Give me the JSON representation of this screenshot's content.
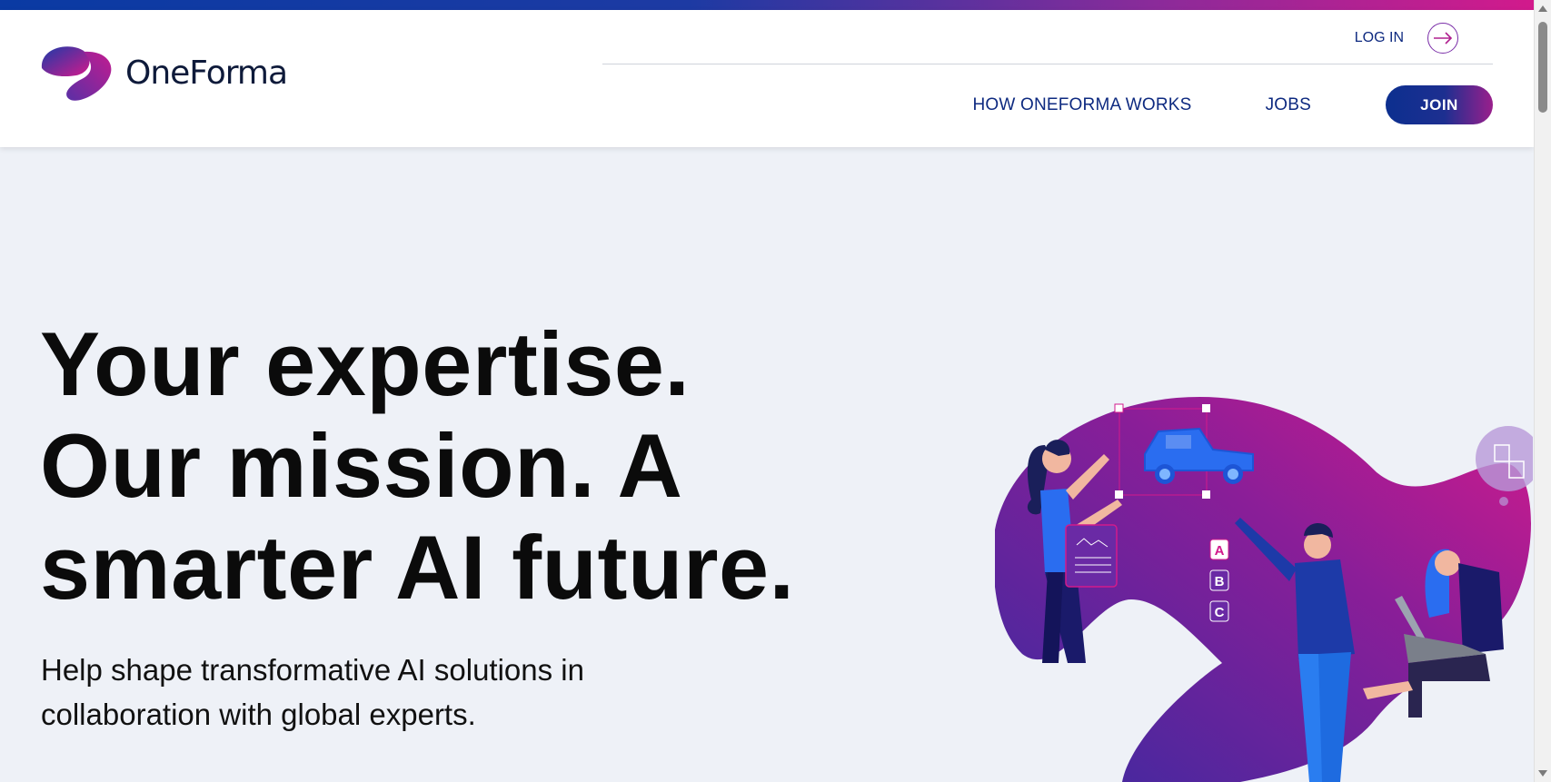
{
  "brand": {
    "name": "OneForma",
    "colors": {
      "navy": "#0e2a80",
      "magenta": "#d21a8c",
      "purple": "#7a2ea8",
      "background": "#eef1f7"
    }
  },
  "header": {
    "login_label": "LOG IN",
    "login_icon": "arrow-right-circle-icon",
    "nav": [
      {
        "label": "HOW ONEFORMA WORKS"
      },
      {
        "label": "JOBS"
      }
    ],
    "join_label": "JOIN"
  },
  "hero": {
    "title": "Your expertise. Our mission. A smarter AI future.",
    "subtitle": "Help shape transformative AI solutions in collaboration with global experts."
  },
  "illustration": {
    "badges": [
      "A",
      "B",
      "C"
    ],
    "icons": [
      "car-icon",
      "document-chart-icon",
      "translate-icon",
      "laptop-icon"
    ]
  }
}
